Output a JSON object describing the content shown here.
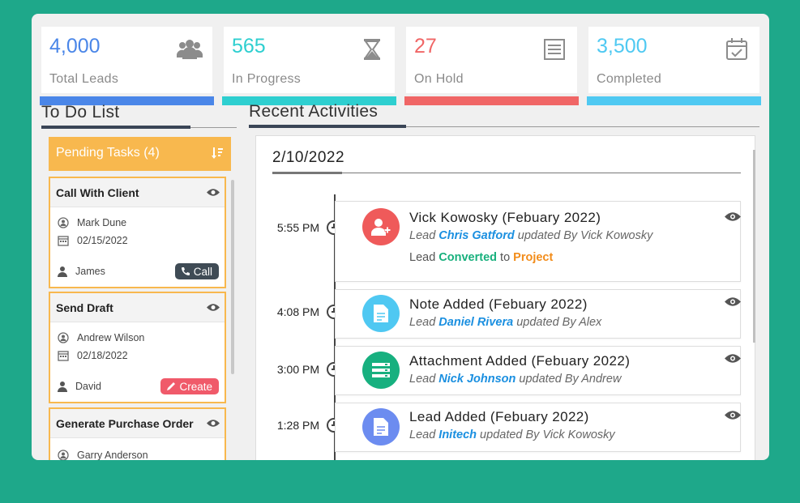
{
  "stats": [
    {
      "value": "4,000",
      "label": "Total Leads",
      "color": "#4a86e8",
      "icon": "users-icon"
    },
    {
      "value": "565",
      "label": "In Progress",
      "color": "#2ecfd0",
      "icon": "hourglass-icon"
    },
    {
      "value": "27",
      "label": "On Hold",
      "color": "#f06666",
      "icon": "list-icon"
    },
    {
      "value": "3,500",
      "label": "Completed",
      "color": "#4fc9f2",
      "icon": "calendar-check-icon"
    }
  ],
  "todo": {
    "title": "To Do List",
    "pending_label": "Pending Tasks (4)",
    "tasks": [
      {
        "title": "Call With Client",
        "contact": "Mark Dune",
        "date": "02/15/2022",
        "owner": "James",
        "action": "Call",
        "action_color": "#3f4b55"
      },
      {
        "title": "Send Draft",
        "contact": "Andrew Wilson",
        "date": "02/18/2022",
        "owner": "David",
        "action": "Create",
        "action_color": "#f05a6a"
      },
      {
        "title": "Generate Purchase Order",
        "contact": "Garry Anderson"
      }
    ]
  },
  "recent": {
    "title": "Recent Activities",
    "date": "2/10/2022",
    "items": [
      {
        "time": "5:55 PM",
        "title": "Vick Kowosky  (Febuary 2022)",
        "pre": "Lead ",
        "name": "Chris Gatford",
        "post": " updated By Vick Kowosky",
        "extra_pre": "Lead ",
        "extra_a": "Converted",
        "extra_mid": " to ",
        "extra_b": "Project",
        "color": "#ef5a5a",
        "icon": "user-add-icon"
      },
      {
        "time": "4:08 PM",
        "title": "Note Added  (Febuary 2022)",
        "pre": "Lead ",
        "name": "Daniel Rivera",
        "post": " updated By Alex",
        "color": "#4fc8f2",
        "icon": "document-icon"
      },
      {
        "time": "3:00 PM",
        "title": "Attachment Added  (Febuary 2022)",
        "pre": "Lead ",
        "name": "Nick Johnson",
        "post": " updated By Andrew",
        "color": "#17b07f",
        "icon": "attachment-icon"
      },
      {
        "time": "1:28 PM",
        "title": "Lead Added  (Febuary 2022)",
        "pre": "Lead ",
        "name": "Initech",
        "post": " updated By Vick Kowosky",
        "color": "#6c8cf0",
        "icon": "document-icon"
      }
    ]
  }
}
